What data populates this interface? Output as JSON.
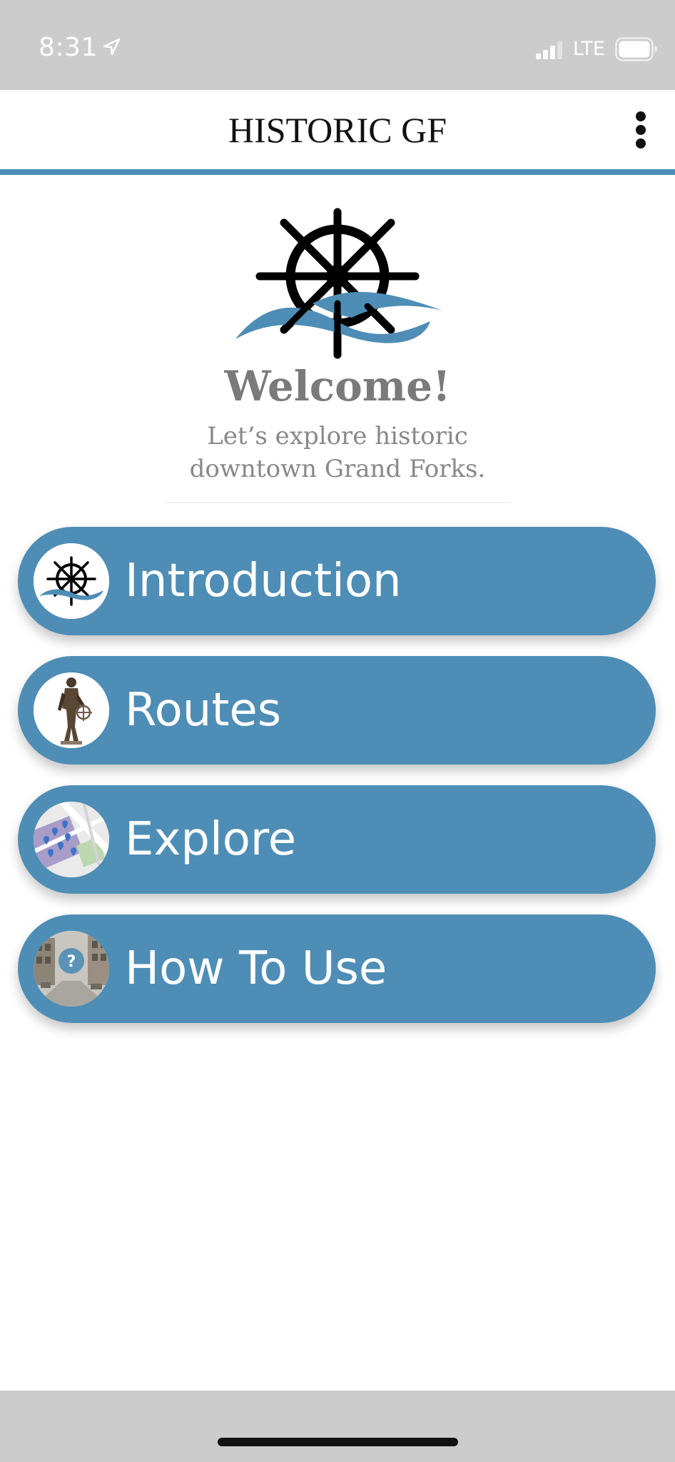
{
  "status_bar": {
    "time": "8:31",
    "network": "LTE"
  },
  "header": {
    "title": "HISTORIC GF",
    "menu_icon": "more-vertical-icon"
  },
  "hero": {
    "logo_icon": "ship-wheel-waves-logo",
    "welcome": "Welcome!",
    "tagline_line1": "Let’s explore historic",
    "tagline_line2": "downtown Grand Forks."
  },
  "nav": {
    "items": [
      {
        "label": "Introduction",
        "icon": "ship-wheel-icon"
      },
      {
        "label": "Routes",
        "icon": "statue-photo-icon"
      },
      {
        "label": "Explore",
        "icon": "map-thumbnail-icon"
      },
      {
        "label": "How To Use",
        "icon": "help-street-photo-icon"
      }
    ]
  },
  "colors": {
    "accent": "#4e8db5",
    "status_bar": "#cccccc",
    "welcome_text": "#7a7a7a"
  }
}
